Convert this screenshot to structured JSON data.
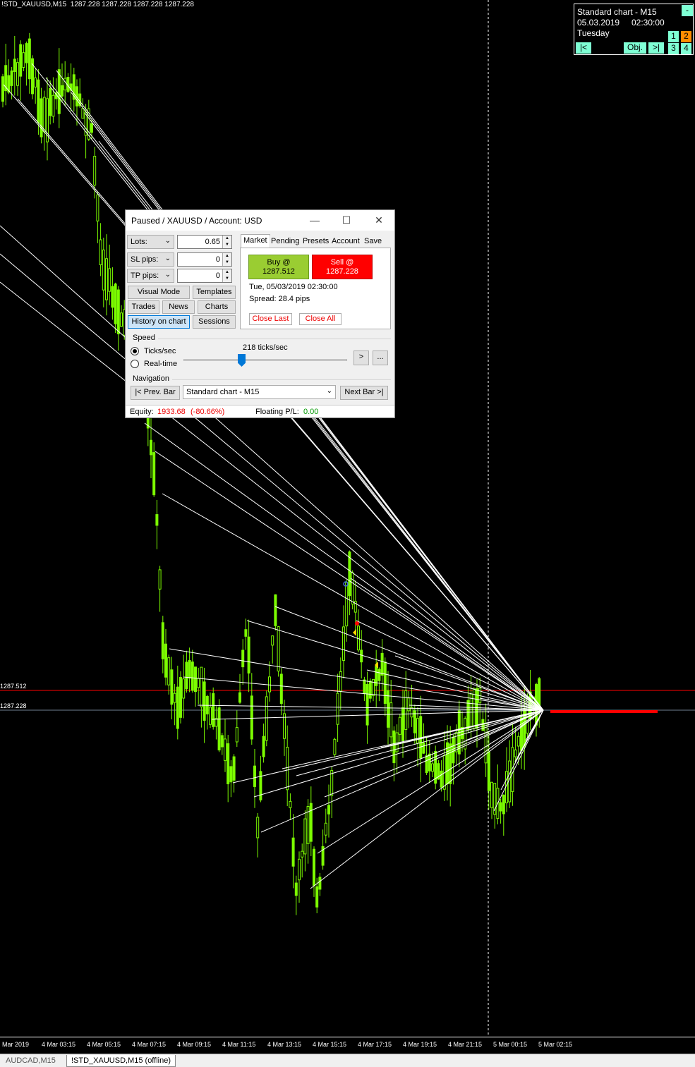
{
  "chart": {
    "header": "!STD_XAUUSD,M15  1287.228 1287.228 1287.228 1287.228",
    "ask_price_label": "1287.512",
    "bid_price_label": "1287.228",
    "colors": {
      "candle": "#7cfc00",
      "ask_line": "#ff0000",
      "bid_line": "#708090",
      "trend_lines": "#ffffff",
      "position_bar": "#ff0000"
    },
    "time_labels": [
      "Mar 2019",
      "4 Mar 03:15",
      "4 Mar 05:15",
      "4 Mar 07:15",
      "4 Mar 09:15",
      "4 Mar 11:15",
      "4 Mar 13:15",
      "4 Mar 15:15",
      "4 Mar 17:15",
      "4 Mar 19:15",
      "4 Mar 21:15",
      "5 Mar 00:15",
      "5 Mar 02:15"
    ]
  },
  "tabs": [
    {
      "label": "AUDCAD,M15",
      "active": false
    },
    {
      "label": "!STD_XAUUSD,M15 (offline)",
      "active": true
    }
  ],
  "info_box": {
    "title": "Standard chart - M15",
    "date": "05.03.2019",
    "time": "02:30:00",
    "weekday": "Tuesday",
    "minimize": "-",
    "nav_first": "|<",
    "objects": "Obj.",
    "nav_next": ">|",
    "slots": [
      "1",
      "2",
      "3",
      "4"
    ]
  },
  "dialog": {
    "title": "Paused / XAUUSD / Account: USD",
    "lots_label": "Lots:",
    "lots_value": "0.65",
    "sl_label": "SL pips:",
    "sl_value": "0",
    "tp_label": "TP pips:",
    "tp_value": "0",
    "buttons": {
      "visual_mode": "Visual Mode",
      "templates": "Templates",
      "trades": "Trades",
      "news": "News",
      "charts": "Charts",
      "history_on_chart": "History on chart",
      "sessions": "Sessions"
    },
    "tabs": [
      "Market",
      "Pending",
      "Presets",
      "Account",
      "Save"
    ],
    "buy_line1": "Buy @",
    "buy_line2": "1287.512",
    "sell_line1": "Sell @",
    "sell_line2": "1287.228",
    "datetime": "Tue, 05/03/2019  02:30:00",
    "spread": "Spread:  28.4 pips",
    "close_last": "Close Last",
    "close_all": "Close All",
    "speed_label": "Speed",
    "ticks_label": "Ticks/sec",
    "realtime_label": "Real-time",
    "ticks_value": "218 ticks/sec",
    "speed_slider_fraction": 0.35,
    "step_btn": ">",
    "more_btn": "...",
    "navigation_label": "Navigation",
    "prev_bar": "|< Prev. Bar",
    "chart_select": "Standard chart - M15",
    "next_bar": "Next Bar >|",
    "equity_label": "Equity:",
    "equity_value": "1933.68",
    "equity_pct": "(-80.66%)",
    "floating_label": "Floating P/L:",
    "floating_value": "0.00"
  }
}
